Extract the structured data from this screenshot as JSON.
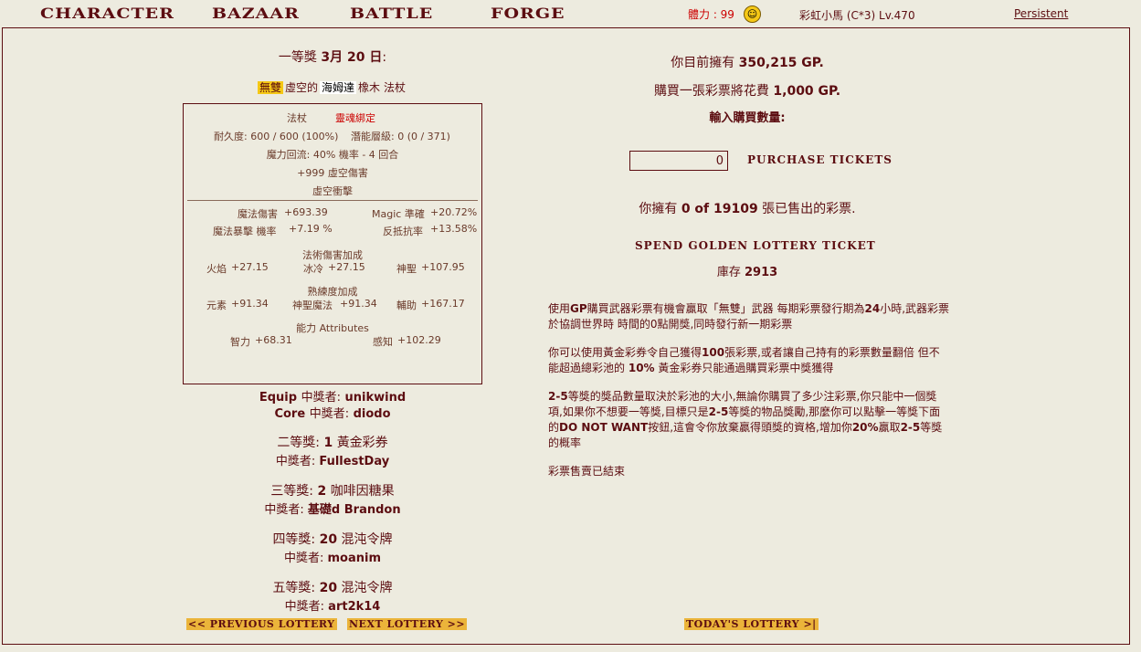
{
  "nav": {
    "items": [
      "CHARACTER",
      "BAZAAR",
      "BATTLE",
      "FORGE"
    ],
    "stamina": "體力 : 99",
    "player": "彩虹小馬 (C*3) Lv.470",
    "persistent": "Persistent"
  },
  "left": {
    "prize1_title_prefix": "一等獎",
    "prize1_date": "3月 20 日",
    "prize1_title_suffix": ":",
    "item_name": {
      "part1": "無雙",
      "part2": "虛空的",
      "part3": "海姆達",
      "part4": "橡木",
      "part5": "法杖"
    },
    "item_box": {
      "type": "法杖",
      "soulbound": "靈魂綁定",
      "durability": "耐久度: 600 / 600 (100%)",
      "potency": "潛能層級: 0 (0 / 371)",
      "mana_return": "魔力回流: 40% 機率 - 4 回合",
      "void_damage": "+999 虛空傷害",
      "void_strike": "虛空衝擊",
      "magic_damage_label": "魔法傷害",
      "magic_damage_value": "+693.39",
      "magic_acc_label": "Magic 準確",
      "magic_acc_value": "+20.72%",
      "crit_label": "魔法暴擊 機率",
      "crit_value": "+7.19 %",
      "counter_label": "反抵抗率",
      "counter_value": "+13.58%",
      "spell_bonus_title": "法術傷害加成",
      "fire_label": "火焰",
      "fire_value": "+27.15",
      "cold_label": "冰冷",
      "cold_value": "+27.15",
      "holy_label": "神聖",
      "holy_value": "+107.95",
      "prof_title": "熟練度加成",
      "elem_label": "元素",
      "elem_value": "+91.34",
      "divine_label": "神聖魔法",
      "divine_value": "+91.34",
      "support_label": "輔助",
      "support_value": "+167.17",
      "attr_title": "能力 Attributes",
      "int_label": "智力",
      "int_value": "+68.31",
      "wis_label": "感知",
      "wis_value": "+102.29"
    },
    "equip_winner_label": "Equip",
    "equip_winner_mid": "中獎者:",
    "equip_winner_name": "unikwind",
    "core_winner_label": "Core",
    "core_winner_mid": "中獎者:",
    "core_winner_name": "diodo",
    "prizes": [
      {
        "rank": "二等獎:",
        "qty": "1",
        "item": "黃金彩券",
        "winner_label": "中獎者:",
        "winner": "FullestDay"
      },
      {
        "rank": "三等獎:",
        "qty": "2",
        "item": "咖啡因糖果",
        "winner_label": "中獎者:",
        "winner": "基礎d Brandon"
      },
      {
        "rank": "四等獎:",
        "qty": "20",
        "item": "混沌令牌",
        "winner_label": "中獎者:",
        "winner": "moanim"
      },
      {
        "rank": "五等獎:",
        "qty": "20",
        "item": "混沌令牌",
        "winner_label": "中獎者:",
        "winner": "art2k14"
      }
    ],
    "prev_lottery": "<< PREVIOUS LOTTERY",
    "next_lottery": "NEXT LOTTERY >>"
  },
  "right": {
    "gp_prefix": "你目前擁有",
    "gp_value": "350,215 GP.",
    "cost_prefix": "購買一張彩票將花費",
    "cost_value": "1,000 GP.",
    "qty_label": "輸入購買數量:",
    "qty_value": "0",
    "purchase_button": "PURCHASE TICKETS",
    "owned_prefix": "你擁有",
    "owned_value": "0 of 19109",
    "owned_suffix": "張已售出的彩票.",
    "spend_golden": "SPEND GOLDEN LOTTERY TICKET",
    "stock_label": "庫存",
    "stock_value": "2913",
    "p1a": "使用",
    "p1b": "GP",
    "p1c": "購買武器彩票有機會贏取「無雙」武器  每期彩票發行期為",
    "p1d": "24",
    "p1e": "小時,武器彩票於協調世界時 時間的0點開獎,同時發行新一期彩票",
    "p2a": "你可以使用黃金彩券令自己獲得",
    "p2b": "100",
    "p2c": "張彩票,或者讓自己持有的彩票數量翻倍 但不能超過總彩池的",
    "p2d": "10%",
    "p2e": "黃金彩券只能通過購買彩票中獎獲得",
    "p3a": "2-5",
    "p3b": "等獎的獎品數量取決於彩池的大小,無論你購買了多少注彩票,你只能中一個獎項,如果你不想要一等獎,目標只是",
    "p3c": "2-5",
    "p3d": "等獎的物品獎勵,那麼你可以點擊一等獎下面的",
    "p3e": "DO NOT WANT",
    "p3f": "按鈕,這會令你放棄贏得頭獎的資格,增加你",
    "p3g": "20%",
    "p3h": "贏取",
    "p3i": "2-5",
    "p3j": "等獎的概率",
    "p4": "彩票售賣已結束",
    "today_lottery": "TODAY'S LOTTERY >|"
  }
}
